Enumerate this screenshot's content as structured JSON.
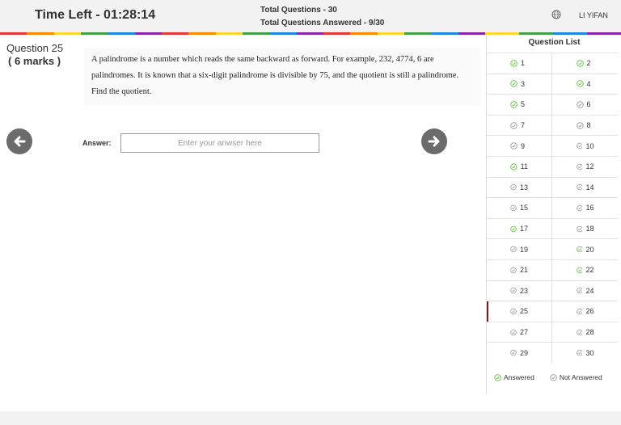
{
  "header": {
    "time_left": "Time Left - 01:28:14",
    "total_questions": "Total Questions - 30",
    "total_answered": "Total Questions Answered - 9/30",
    "username": "LI YIFAN"
  },
  "question": {
    "number": "Question 25",
    "marks": "( 6 marks )",
    "text": "A palindrome is a number which reads the same backward as forward. For example, 232, 4774, 6 are palindromes. It is known that a six-digit palindrome is divisible by 75, and the quotient is still a palindrome. Find the quotient."
  },
  "answer": {
    "label": "Answer:",
    "placeholder": "Enter your anwser here"
  },
  "panel": {
    "title": "Question List",
    "current": 25,
    "items": [
      {
        "num": "1",
        "answered": true
      },
      {
        "num": "2",
        "answered": true
      },
      {
        "num": "3",
        "answered": true
      },
      {
        "num": "4",
        "answered": true
      },
      {
        "num": "5",
        "answered": true
      },
      {
        "num": "6",
        "answered": false
      },
      {
        "num": "7",
        "answered": false
      },
      {
        "num": "8",
        "answered": false
      },
      {
        "num": "9",
        "answered": false
      },
      {
        "num": "10",
        "answered": false
      },
      {
        "num": "11",
        "answered": true
      },
      {
        "num": "12",
        "answered": false
      },
      {
        "num": "13",
        "answered": false
      },
      {
        "num": "14",
        "answered": false
      },
      {
        "num": "15",
        "answered": false
      },
      {
        "num": "16",
        "answered": false
      },
      {
        "num": "17",
        "answered": true
      },
      {
        "num": "18",
        "answered": false
      },
      {
        "num": "19",
        "answered": false
      },
      {
        "num": "20",
        "answered": true
      },
      {
        "num": "21",
        "answered": false
      },
      {
        "num": "22",
        "answered": true
      },
      {
        "num": "23",
        "answered": false
      },
      {
        "num": "24",
        "answered": false
      },
      {
        "num": "25",
        "answered": false
      },
      {
        "num": "26",
        "answered": false
      },
      {
        "num": "27",
        "answered": false
      },
      {
        "num": "28",
        "answered": false
      },
      {
        "num": "29",
        "answered": false
      },
      {
        "num": "30",
        "answered": false
      }
    ],
    "legend_answered": "Answered",
    "legend_not_answered": "Not Answered"
  },
  "colors": {
    "answered": "#5bc236",
    "not_answered": "#999999",
    "nav_button": "#6b6b6b",
    "current_marker": "#7a1c1c",
    "rainbow": [
      "#e53935",
      "#fb8c00",
      "#fdd835",
      "#43a047",
      "#1e88e5",
      "#8e24aa",
      "#e53935",
      "#fb8c00",
      "#fdd835",
      "#43a047",
      "#1e88e5",
      "#8e24aa",
      "#e53935",
      "#fb8c00",
      "#fdd835",
      "#43a047",
      "#1e88e5",
      "#8e24aa"
    ]
  },
  "icons": {
    "prev": "arrow-left-icon",
    "next": "arrow-right-icon",
    "globe": "globe-icon",
    "answered": "check-circle-icon",
    "not_answered": "check-circle-outline-icon"
  }
}
